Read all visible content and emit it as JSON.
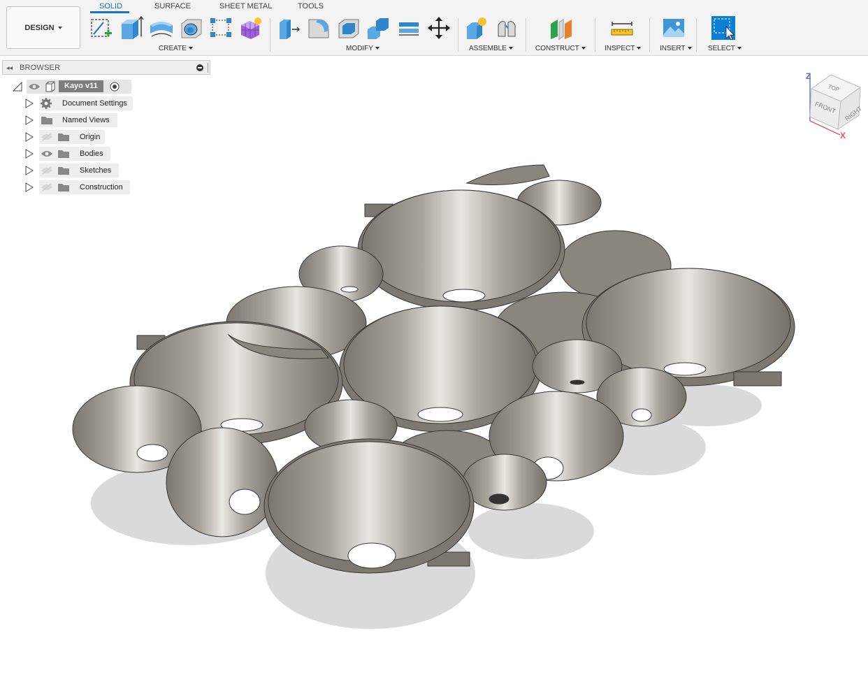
{
  "workspace": {
    "label": "DESIGN"
  },
  "tabs": [
    {
      "label": "SOLID",
      "active": true
    },
    {
      "label": "SURFACE",
      "active": false
    },
    {
      "label": "SHEET METAL",
      "active": false
    },
    {
      "label": "TOOLS",
      "active": false
    }
  ],
  "toolbar_groups": {
    "create": "CREATE",
    "modify": "MODIFY",
    "assemble": "ASSEMBLE",
    "construct": "CONSTRUCT",
    "inspect": "INSPECT",
    "insert": "INSERT",
    "select": "SELECT"
  },
  "browser": {
    "title": "BROWSER",
    "root": "Kayo v11",
    "items": [
      {
        "label": "Document Settings",
        "icon": "gear-icon",
        "visible": null
      },
      {
        "label": "Named Views",
        "icon": "folder-icon",
        "visible": null
      },
      {
        "label": "Origin",
        "icon": "folder-icon",
        "visible": false
      },
      {
        "label": "Bodies",
        "icon": "folder-icon",
        "visible": true
      },
      {
        "label": "Sketches",
        "icon": "folder-icon",
        "visible": false
      },
      {
        "label": "Construction",
        "icon": "folder-icon",
        "visible": false
      }
    ]
  },
  "viewcube": {
    "top": "TOP",
    "front": "FRONT",
    "right": "RIGHT",
    "axis_z": "Z",
    "axis_x": "X"
  },
  "colors": {
    "accent": "#1a74c6",
    "model_metal": "#8a867e",
    "axis_z": "#5a6fd6",
    "axis_x": "#e0555c"
  }
}
